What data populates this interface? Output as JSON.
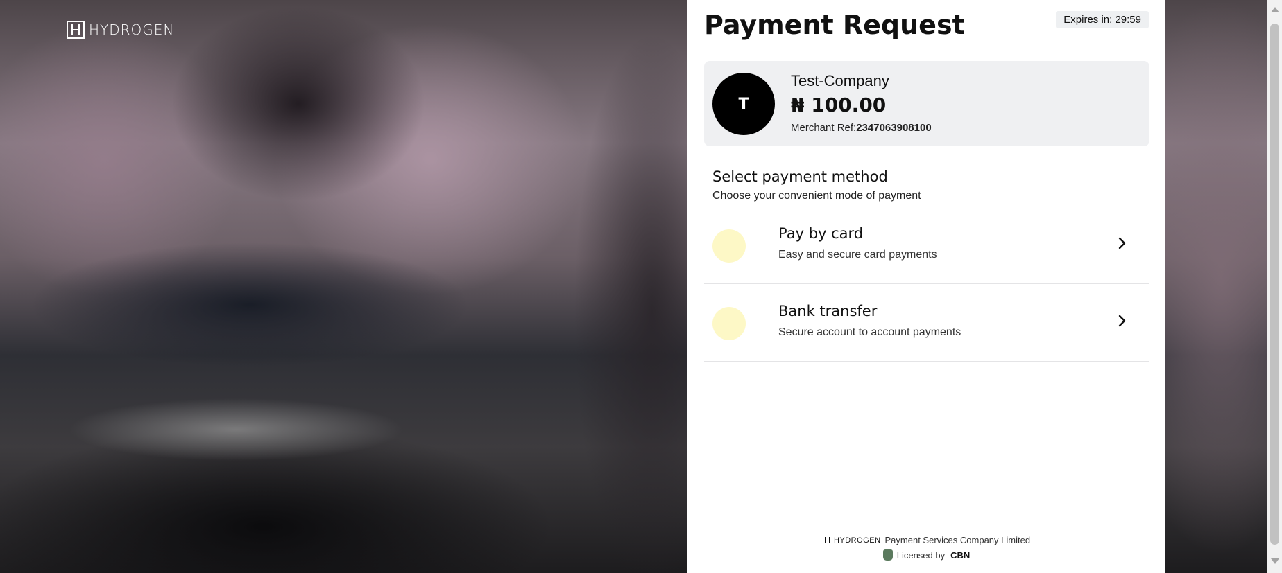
{
  "brand": {
    "name": "HYDROGEN"
  },
  "header": {
    "title": "Payment Request",
    "expires": "Expires in: 29:59"
  },
  "merchant": {
    "initial": "T",
    "name": "Test-Company",
    "amount": "₦ 100.00",
    "ref_label": "Merchant Ref:",
    "ref_value": "2347063908100"
  },
  "methods_section": {
    "title": "Select payment method",
    "subtitle": "Choose your convenient mode of payment"
  },
  "methods": [
    {
      "title": "Pay by card",
      "subtitle": "Easy and secure card payments",
      "icon": "chevron-right-icon"
    },
    {
      "title": "Bank transfer",
      "subtitle": "Secure account to account payments",
      "icon": "chevron-right-icon"
    }
  ],
  "footer": {
    "company": "Payment Services Company Limited",
    "licensed_by": "Licensed by",
    "regulator": "CBN"
  },
  "colors": {
    "method_dot": "#fdf8c6",
    "card_bg": "#eff0f2",
    "avatar_bg": "#000000"
  }
}
